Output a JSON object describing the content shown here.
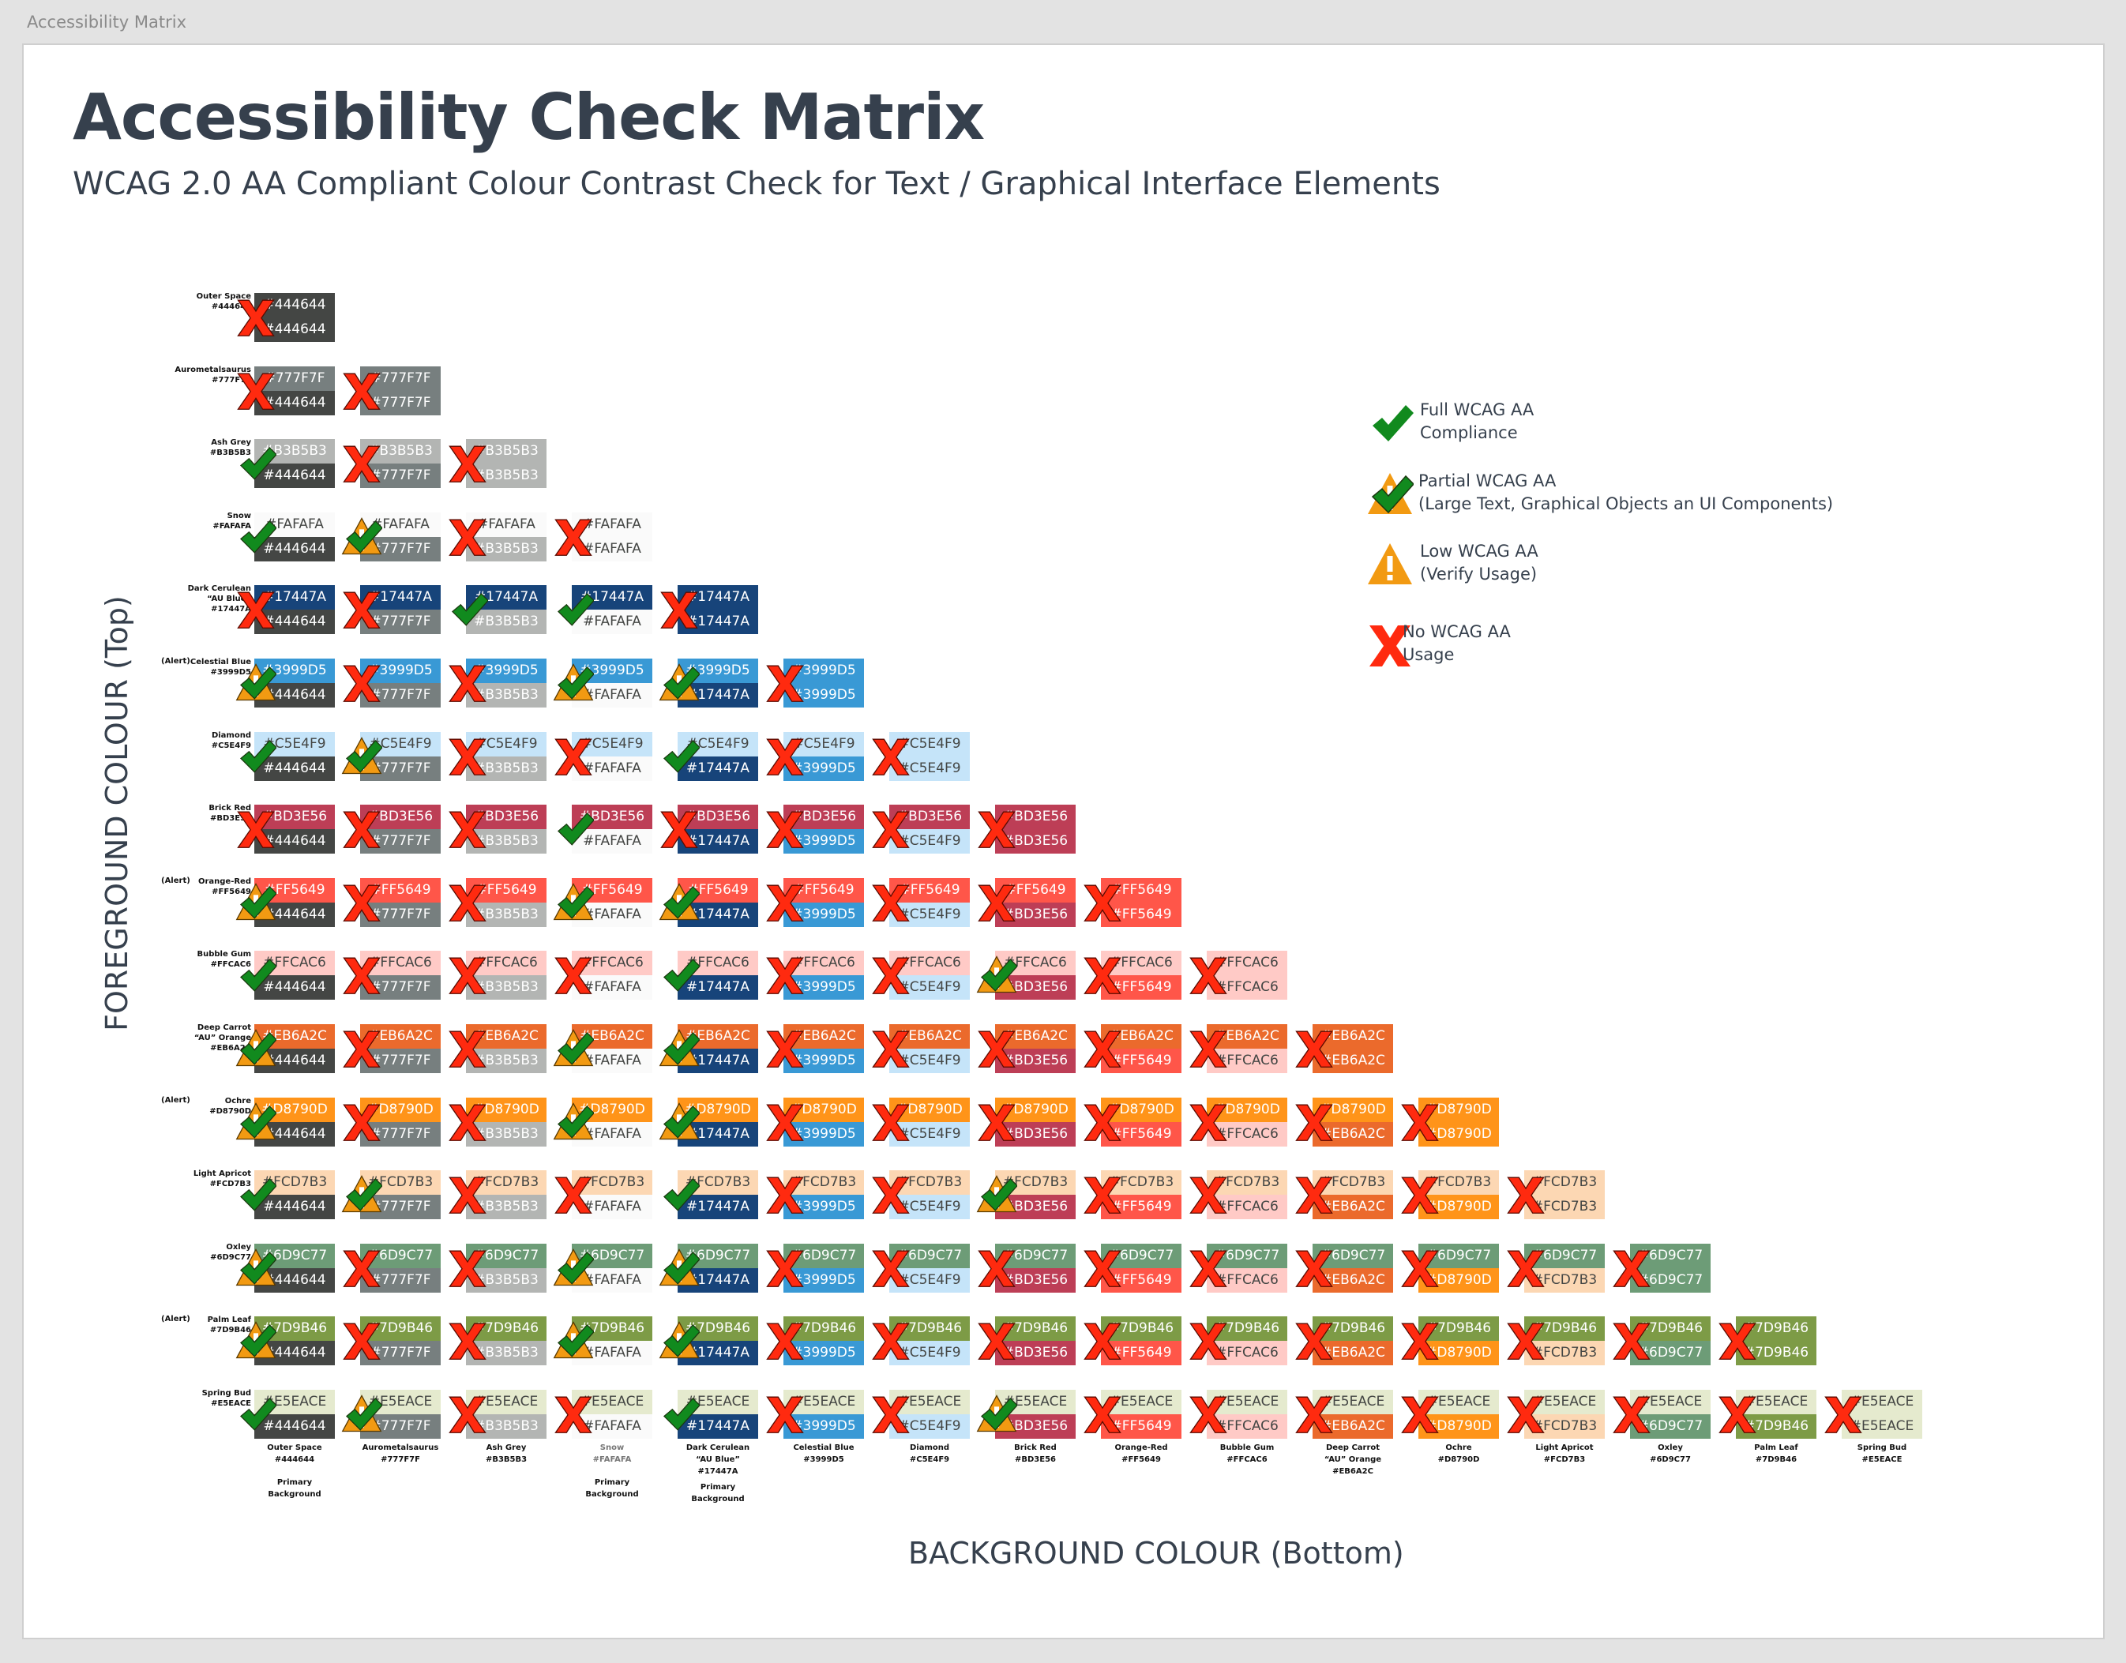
{
  "window": {
    "title": "Accessibility Matrix"
  },
  "header": {
    "title": "Accessibility Check Matrix",
    "subtitle": "WCAG 2.0 AA Compliant Colour Contrast Check for Text / Graphical Interface Elements"
  },
  "axes": {
    "y_label": "FOREGROUND COLOUR (Top)",
    "x_label": "BACKGROUND COLOUR (Bottom)"
  },
  "legend": [
    {
      "status": "full",
      "icon": "check-icon",
      "line1": "Full WCAG AA",
      "line2": "Compliance"
    },
    {
      "status": "partial",
      "icon": "warning-check-icon",
      "line1": "Partial WCAG AA",
      "line2": "(Large Text, Graphical Objects an UI Components)"
    },
    {
      "status": "low",
      "icon": "warning-icon",
      "line1": "Low WCAG AA",
      "line2": "(Verify Usage)"
    },
    {
      "status": "none",
      "icon": "x-icon",
      "line1": "No WCAG AA",
      "line2": "Usage"
    }
  ],
  "status_colors": {
    "full": "#118a1e",
    "warning": "#f29a12",
    "none": "#ff2a0f"
  },
  "colours": [
    {
      "name": "Outer Space",
      "name2": "",
      "hex": "#444644",
      "text": "#ffffff",
      "alert": false,
      "note": "Primary Background"
    },
    {
      "name": "Aurometalsaurus",
      "name2": "",
      "hex": "#777F7F",
      "text": "#ffffff",
      "alert": false,
      "note": ""
    },
    {
      "name": "Ash Grey",
      "name2": "",
      "hex": "#B3B5B3",
      "text": "#ffffff",
      "alert": false,
      "note": ""
    },
    {
      "name": "Snow",
      "name2": "",
      "hex": "#FAFAFA",
      "text": "#444644",
      "alert": false,
      "note": "Primary Background"
    },
    {
      "name": "Dark Cerulean",
      "name2": "“AU Blue”",
      "hex": "#17447A",
      "text": "#ffffff",
      "alert": false,
      "note": "Primary Background"
    },
    {
      "name": "Celestial Blue",
      "name2": "",
      "hex": "#3999D5",
      "text": "#ffffff",
      "alert": true,
      "note": ""
    },
    {
      "name": "Diamond",
      "name2": "",
      "hex": "#C5E4F9",
      "text": "#444644",
      "alert": false,
      "note": ""
    },
    {
      "name": "Brick Red",
      "name2": "",
      "hex": "#BD3E56",
      "text": "#ffffff",
      "alert": false,
      "note": ""
    },
    {
      "name": "Orange-Red",
      "name2": "",
      "hex": "#FF5649",
      "text": "#ffffff",
      "alert": true,
      "note": ""
    },
    {
      "name": "Bubble Gum",
      "name2": "",
      "hex": "#FFCAC6",
      "text": "#444644",
      "alert": false,
      "note": ""
    },
    {
      "name": "Deep Carrot",
      "name2": "“AU” Orange",
      "hex": "#EB6A2C",
      "text": "#ffffff",
      "alert": false,
      "note": ""
    },
    {
      "name": "Ochre",
      "name2": "",
      "hex": "#D8790D",
      "display": "#FF9419",
      "text": "#ffffff",
      "alert": true,
      "note": ""
    },
    {
      "name": "Light Apricot",
      "name2": "",
      "hex": "#FCD7B3",
      "text": "#444644",
      "alert": false,
      "note": ""
    },
    {
      "name": "Oxley",
      "name2": "",
      "hex": "#6D9C77",
      "text": "#ffffff",
      "alert": false,
      "note": ""
    },
    {
      "name": "Palm Leaf",
      "name2": "",
      "hex": "#7D9B46",
      "text": "#ffffff",
      "alert": true,
      "note": ""
    },
    {
      "name": "Spring Bud",
      "name2": "",
      "hex": "#E5EACE",
      "text": "#444644",
      "alert": false,
      "note": ""
    }
  ],
  "alert_label": "(Alert)",
  "matrix": [
    [
      "x"
    ],
    [
      "x",
      "x"
    ],
    [
      "f",
      "x",
      "x"
    ],
    [
      "f",
      "p",
      "x",
      "x"
    ],
    [
      "x",
      "x",
      "f",
      "f",
      "x"
    ],
    [
      "p",
      "x",
      "x",
      "p",
      "p",
      "x"
    ],
    [
      "f",
      "p",
      "x",
      "x",
      "f",
      "x",
      "x"
    ],
    [
      "x",
      "x",
      "x",
      "f",
      "x",
      "x",
      "x",
      "x"
    ],
    [
      "p",
      "x",
      "x",
      "p",
      "p",
      "x",
      "x",
      "x",
      "x"
    ],
    [
      "f",
      "x",
      "x",
      "x",
      "f",
      "x",
      "x",
      "p",
      "x",
      "x"
    ],
    [
      "p",
      "x",
      "x",
      "p",
      "p",
      "x",
      "x",
      "x",
      "x",
      "x",
      "x"
    ],
    [
      "p",
      "x",
      "x",
      "p",
      "p",
      "x",
      "x",
      "x",
      "x",
      "x",
      "x",
      "x"
    ],
    [
      "f",
      "p",
      "x",
      "x",
      "f",
      "x",
      "x",
      "p",
      "x",
      "x",
      "x",
      "x",
      "x"
    ],
    [
      "p",
      "x",
      "x",
      "p",
      "p",
      "x",
      "x",
      "x",
      "x",
      "x",
      "x",
      "x",
      "x",
      "x"
    ],
    [
      "p",
      "x",
      "x",
      "p",
      "p",
      "x",
      "x",
      "x",
      "x",
      "x",
      "x",
      "x",
      "x",
      "x",
      "x"
    ],
    [
      "f",
      "p",
      "x",
      "x",
      "f",
      "x",
      "x",
      "p",
      "x",
      "x",
      "x",
      "x",
      "x",
      "x",
      "x",
      "x"
    ]
  ]
}
